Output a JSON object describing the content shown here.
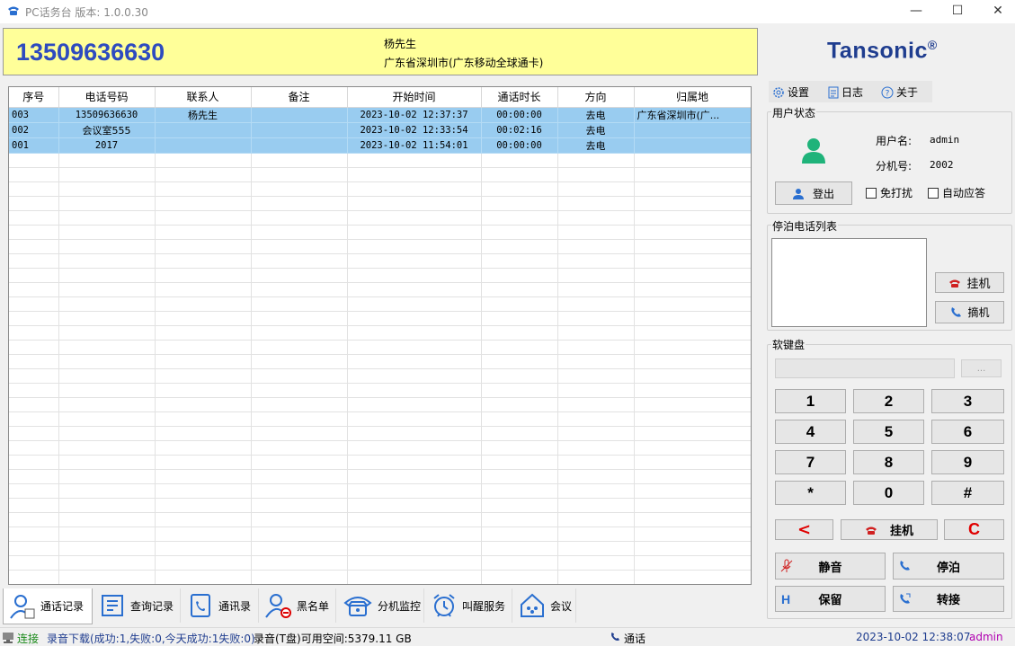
{
  "window": {
    "title": "PC话务台 版本: 1.0.0.30",
    "controls": {
      "minimize": "—",
      "maximize": "☐",
      "close": "✕"
    }
  },
  "caller": {
    "number": "13509636630",
    "name": "杨先生",
    "location": "广东省深圳市(广东移动全球通卡)"
  },
  "brand": {
    "name": "Tansonic",
    "mark": "®"
  },
  "call_table": {
    "columns": [
      "序号",
      "电话号码",
      "联系人",
      "备注",
      "开始时间",
      "通话时长",
      "方向",
      "归属地"
    ],
    "rows": [
      {
        "id": "003",
        "number": "13509636630",
        "contact": "杨先生",
        "note": "",
        "start": "2023-10-02 12:37:37",
        "duration": "00:00:00",
        "direction": "去电",
        "location": "广东省深圳市(广..."
      },
      {
        "id": "002",
        "number": "会议室555",
        "contact": "",
        "note": "",
        "start": "2023-10-02 12:33:54",
        "duration": "00:02:16",
        "direction": "去电",
        "location": ""
      },
      {
        "id": "001",
        "number": "2017",
        "contact": "",
        "note": "",
        "start": "2023-10-02 11:54:01",
        "duration": "00:00:00",
        "direction": "去电",
        "location": ""
      }
    ]
  },
  "tabs": [
    {
      "label": "通话记录",
      "icon": "call-log-icon"
    },
    {
      "label": "查询记录",
      "icon": "search-record-icon"
    },
    {
      "label": "通讯录",
      "icon": "contacts-icon"
    },
    {
      "label": "黑名单",
      "icon": "blacklist-icon"
    },
    {
      "label": "分机监控",
      "icon": "extension-monitor-icon"
    },
    {
      "label": "叫醒服务",
      "icon": "alarm-clock-icon"
    },
    {
      "label": "会议",
      "icon": "conference-icon"
    }
  ],
  "toolbar": {
    "settings": "设置",
    "log": "日志",
    "about": "关于"
  },
  "user_status": {
    "title": "用户状态",
    "username_label": "用户名:",
    "username": "admin",
    "ext_label": "分机号:",
    "ext": "2002",
    "logout": "登出",
    "dnd": "免打扰",
    "auto_answer": "自动应答"
  },
  "parked": {
    "title": "停泊电话列表",
    "hangup": "挂机",
    "pickup": "摘机"
  },
  "keypad": {
    "title": "软键盘",
    "dial_button": "...",
    "keys": [
      "1",
      "2",
      "3",
      "4",
      "5",
      "6",
      "7",
      "8",
      "9",
      "*",
      "0",
      "#"
    ],
    "back": "<",
    "hangup": "挂机",
    "clear": "C",
    "mute": "静音",
    "park": "停泊",
    "hold": "保留",
    "transfer": "转接"
  },
  "status": {
    "connected": "连接",
    "download": "录音下载(成功:1,失败:0,今天成功:1失败:0)",
    "disk": "录音(T盘)可用空间:5379.11 GB",
    "call_state": "通话",
    "datetime": "2023-10-02 12:38:07",
    "user": "admin"
  },
  "colors": {
    "caller_bg": "#ffff99",
    "caller_number": "#2e4bbf",
    "selected_row": "#99ccf0",
    "brand": "#1f3d8f",
    "status_user": "#b000b0",
    "status_datetime": "#1f3d8f",
    "clear_key": "#e00000"
  }
}
